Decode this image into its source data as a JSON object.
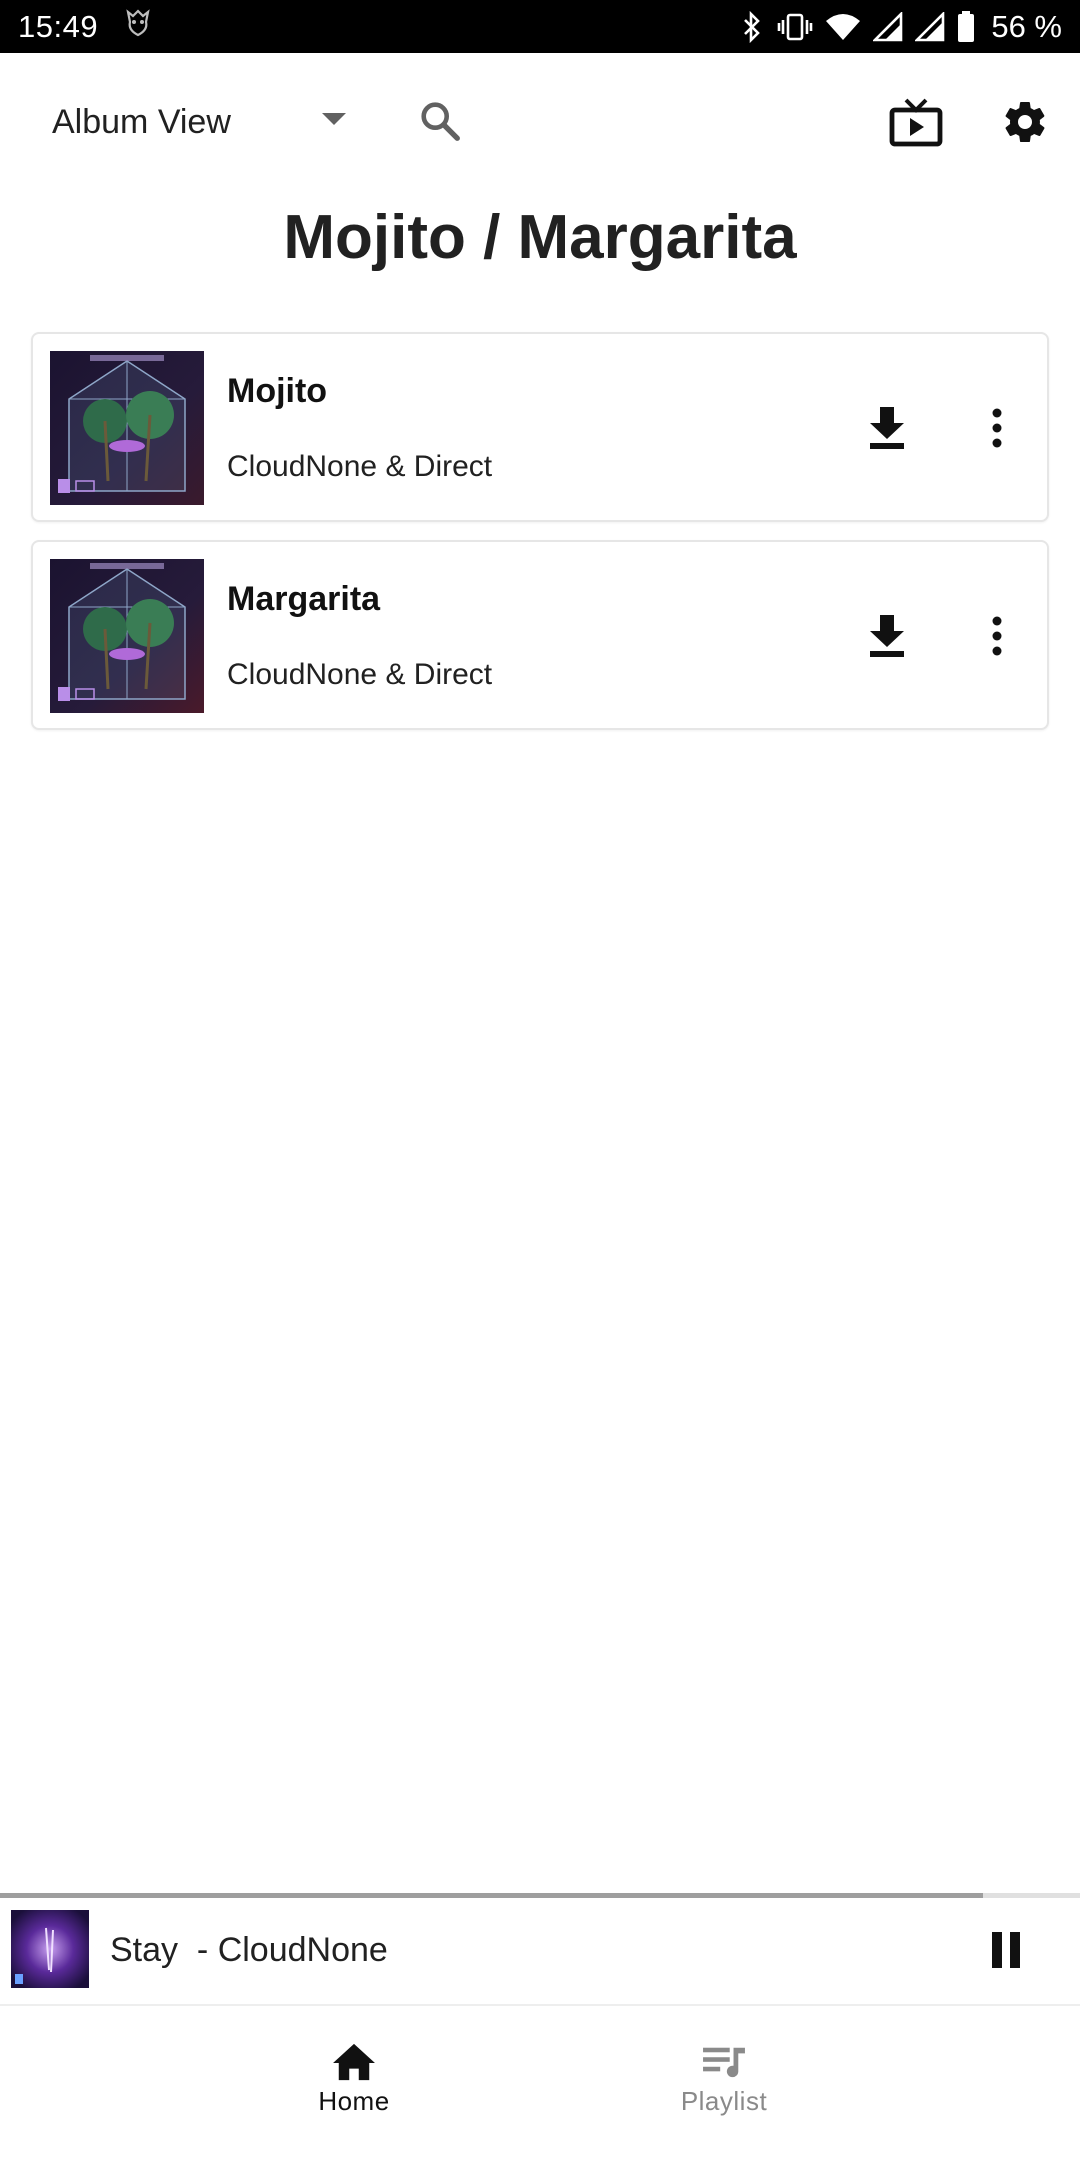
{
  "status_bar": {
    "time": "15:49",
    "battery": "56 %",
    "icons": [
      "app-notification-icon",
      "bluetooth-icon",
      "vibrate-icon",
      "wifi-icon",
      "signal-icon",
      "signal-icon",
      "battery-icon"
    ]
  },
  "header": {
    "view_select": "Album View",
    "icons": {
      "search": "search-icon",
      "cast": "cast-icon",
      "settings": "gear-icon"
    }
  },
  "page_title": "Mojito / Margarita",
  "tracks": [
    {
      "title": "Mojito",
      "artist": "CloudNone & Direct"
    },
    {
      "title": "Margarita",
      "artist": "CloudNone & Direct"
    }
  ],
  "now_playing": {
    "text": "Stay  - CloudNone",
    "progress": 0.91
  },
  "bottom_nav": [
    {
      "label": "Home",
      "icon": "home-icon",
      "active": true
    },
    {
      "label": "Playlist",
      "icon": "playlist-icon",
      "active": false
    }
  ],
  "colors": {
    "status_bar_bg": "#000000",
    "text_primary": "#212121",
    "nav_inactive": "#8a8a8a",
    "card_border": "#e6e6e6",
    "progress": "#9e9e9e"
  }
}
